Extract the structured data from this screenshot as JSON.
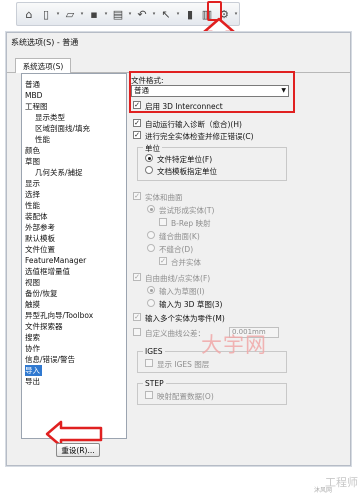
{
  "dialog": {
    "title": "系统选项(S) - 普通",
    "tab": "系统选项(S)",
    "reset_button": "重设(R)..."
  },
  "tree": {
    "items": [
      {
        "label": "普通",
        "level": 0
      },
      {
        "label": "MBD",
        "level": 0
      },
      {
        "label": "工程图",
        "level": 0
      },
      {
        "label": "显示类型",
        "level": 1
      },
      {
        "label": "区域剖面线/填充",
        "level": 1
      },
      {
        "label": "性能",
        "level": 1
      },
      {
        "label": "颜色",
        "level": 0
      },
      {
        "label": "草图",
        "level": 0
      },
      {
        "label": "几何关系/捕捉",
        "level": 1
      },
      {
        "label": "显示",
        "level": 0
      },
      {
        "label": "选择",
        "level": 0
      },
      {
        "label": "性能",
        "level": 0
      },
      {
        "label": "装配体",
        "level": 0
      },
      {
        "label": "外部参考",
        "level": 0
      },
      {
        "label": "默认模板",
        "level": 0
      },
      {
        "label": "文件位置",
        "level": 0
      },
      {
        "label": "FeatureManager",
        "level": 0
      },
      {
        "label": "选值框增量值",
        "level": 0
      },
      {
        "label": "视图",
        "level": 0
      },
      {
        "label": "备份/恢复",
        "level": 0
      },
      {
        "label": "触摸",
        "level": 0
      },
      {
        "label": "异型孔向导/Toolbox",
        "level": 0
      },
      {
        "label": "文件探索器",
        "level": 0
      },
      {
        "label": "搜索",
        "level": 0
      },
      {
        "label": "协作",
        "level": 0
      },
      {
        "label": "信息/错误/警告",
        "level": 0
      },
      {
        "label": "导入",
        "level": 0,
        "selected": true
      },
      {
        "label": "导出",
        "level": 0
      }
    ]
  },
  "panel": {
    "file_format_label": "文件格式:",
    "file_format_value": "普通",
    "enable_3d_interconnect": "启用 3D Interconnect",
    "auto_diagnose": "自动运行输入诊断（愈合)(H)",
    "full_check": "进行完全实体检查并修正错误(C)",
    "unit_group": "单位",
    "unit_file": "文件特定单位(F)",
    "unit_template": "文档模板指定单位",
    "solid_surface": "实体和曲面",
    "try_solid": "尝试形成实体(T)",
    "brep": "B-Rep 映射",
    "knit": "缝合曲面(K)",
    "no_knit": "不缝合(D)",
    "merge": "合并实体",
    "free_curve": "自由曲线/点实体(F)",
    "as_sketch": "输入为草图(I)",
    "as_3d_sketch": "输入为 3D 草图(3)",
    "multi_parts": "输入多个实体为零件(M)",
    "custom_tolerance": "自定义曲线公差：",
    "tolerance_value": "0.001mm",
    "iges_group": "IGES",
    "iges_show": "显示 IGES 图层",
    "step_group": "STEP",
    "step_map": "映射配置数据(O)"
  },
  "watermark": {
    "main": "大宇网",
    "corner": "工程师",
    "site": "沐风网"
  },
  "colors": {
    "highlight": "#e02020",
    "selected": "#3079d0"
  },
  "toolbar_icons": [
    "home-icon",
    "new-document-icon",
    "open-folder-icon",
    "save-icon",
    "print-icon",
    "undo-icon",
    "select-arrow-icon",
    "rebuild-icon",
    "file-properties-icon",
    "options-gear-icon"
  ]
}
